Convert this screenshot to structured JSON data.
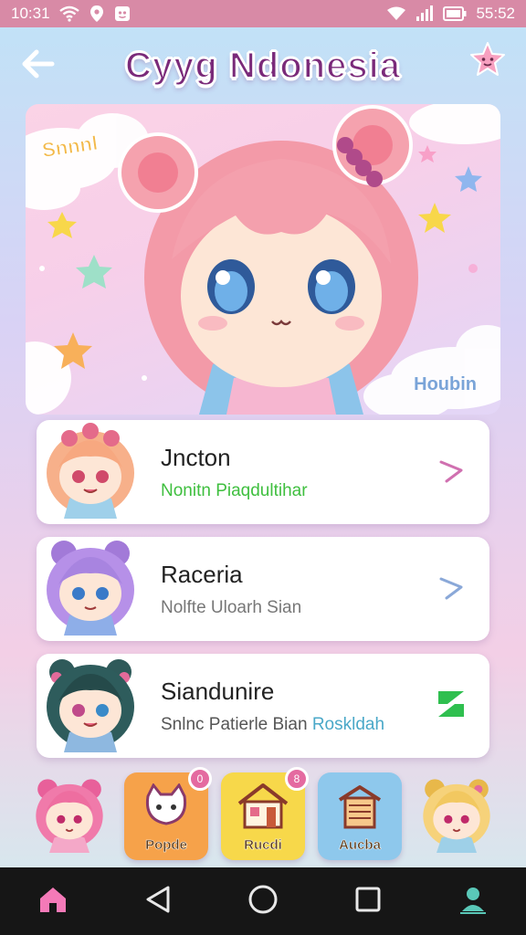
{
  "status_bar": {
    "time_left": "10:31",
    "time_right": "55:52",
    "icons": [
      "wifi-icon",
      "location-icon",
      "notification-icon",
      "wifi-icon",
      "signal-icon",
      "battery-icon"
    ]
  },
  "header": {
    "title": "Cyyg Ndonesia",
    "back_icon": "back-arrow-icon",
    "action_icon": "star-face-icon"
  },
  "hero": {
    "label_left": "Snnnl",
    "label_right": "Houbin"
  },
  "cards": [
    {
      "title": "Jncton",
      "subtitle": "Nonitn Piaqdultihar",
      "subtitle_color": "#3fbf3f",
      "action_icon": "chevron-icon",
      "action_color": "#d070b0"
    },
    {
      "title": "Raceria",
      "subtitle": "Nolfte Uloarh Sian",
      "subtitle_color": "#777777",
      "action_icon": "chevron-icon",
      "action_color": "#8aa8d8"
    },
    {
      "title": "Siandunire",
      "subtitle_a": "Snlnc Patierle Bian",
      "subtitle_b": "Roskldah",
      "subtitle_color": "#555555",
      "subtitle_b_color": "#4aa8c8",
      "action_icon": "z-badge-icon",
      "action_color": "#2fbf4f"
    }
  ],
  "tray": [
    {
      "label": "",
      "kind": "avatar"
    },
    {
      "label": "Popde",
      "badge": "0",
      "color": "#f6a24a"
    },
    {
      "label": "Rucdi",
      "badge": "8",
      "color": "#f7d84a"
    },
    {
      "label": "Aucba",
      "color": "#8ec8ec"
    },
    {
      "label": "",
      "kind": "avatar"
    }
  ],
  "nav": {
    "icons": [
      "home-icon",
      "back-triangle-icon",
      "home-circle-icon",
      "recents-square-icon",
      "profile-icon"
    ]
  },
  "colors": {
    "status_bar": "#d88aa6",
    "title": "#7a2a7a",
    "nav_bar": "#161616"
  }
}
